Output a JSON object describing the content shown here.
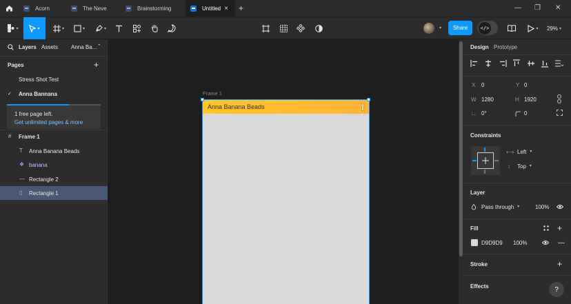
{
  "tabs": [
    {
      "label": "Acorn",
      "active": false
    },
    {
      "label": "The Neve",
      "active": false
    },
    {
      "label": "Brainstorming",
      "active": false
    },
    {
      "label": "Untitled",
      "active": true
    }
  ],
  "tabbar": {
    "close_glyph": "×",
    "new_tab_glyph": "+",
    "minimize": "—",
    "restore": "❐",
    "close": "✕"
  },
  "toolbar": {
    "tools": [
      "main-menu-icon",
      "move-icon",
      "frame-icon",
      "shape-icon",
      "pen-icon",
      "text-icon",
      "resources-icon",
      "hand-icon",
      "comment-icon"
    ],
    "center_tools": [
      "crop-icon",
      "grid-icon",
      "component-icon",
      "contrast-icon"
    ],
    "share_label": "Share",
    "dev_mode_glyph": "</>",
    "zoom": "29%",
    "accent_color": "#0d99ff"
  },
  "left_panel": {
    "tab_layers": "Layers",
    "tab_assets": "Assets",
    "page_switcher": "Anna Ba...",
    "pages_heading": "Pages",
    "pages": [
      {
        "name": "Stress Shot Test",
        "current": false
      },
      {
        "name": "Anna Bannana",
        "current": true
      }
    ],
    "upsell_title": "1 free page left.",
    "upsell_link": "Get unlimited pages & more",
    "layers": [
      {
        "name": "Frame 1",
        "icon": "frame-icon"
      },
      {
        "name": "Anna Banana Beads",
        "icon": "text-icon"
      },
      {
        "name": "banana",
        "icon": "component-icon"
      },
      {
        "name": "Rectangle 2",
        "icon": "line-icon"
      },
      {
        "name": "Rectangle 1",
        "icon": "rectangle-icon",
        "selected": true
      }
    ]
  },
  "canvas": {
    "frame_label": "Frame 1",
    "header_text": "Anna Banana Beads",
    "frame_fill": "#d9d9d9",
    "header_color": "#ffc629"
  },
  "right_panel": {
    "tab_design": "Design",
    "tab_prototype": "Prototype",
    "x_label": "X",
    "x_value": "0",
    "y_label": "Y",
    "y_value": "0",
    "w_label": "W",
    "w_value": "1280",
    "h_label": "H",
    "h_value": "1920",
    "rotation_value": "0°",
    "radius_value": "0",
    "constraints_heading": "Constraints",
    "constraint_h": "Left",
    "constraint_v": "Top",
    "layer_heading": "Layer",
    "blend_mode": "Pass through",
    "layer_opacity": "100%",
    "fill_heading": "Fill",
    "fill_hex": "D9D9D9",
    "fill_opacity": "100%",
    "stroke_heading": "Stroke",
    "effects_heading": "Effects",
    "help_glyph": "?"
  }
}
